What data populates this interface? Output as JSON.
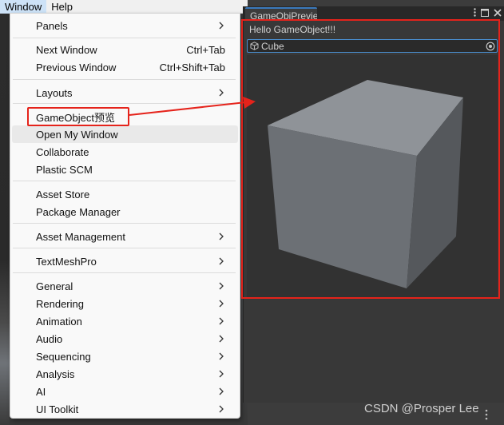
{
  "menubar": {
    "items": [
      "Window",
      "Help"
    ]
  },
  "menu": {
    "items": [
      {
        "label": "Panels",
        "shortcut": "",
        "submenu": true
      },
      {
        "label": "Next Window",
        "shortcut": "Ctrl+Tab",
        "submenu": false
      },
      {
        "label": "Previous Window",
        "shortcut": "Ctrl+Shift+Tab",
        "submenu": false
      },
      {
        "label": "Layouts",
        "shortcut": "",
        "submenu": true
      },
      {
        "label": "GameObject预览",
        "shortcut": "",
        "submenu": false
      },
      {
        "label": "Open My Window",
        "shortcut": "",
        "submenu": false
      },
      {
        "label": "Collaborate",
        "shortcut": "",
        "submenu": false
      },
      {
        "label": "Plastic SCM",
        "shortcut": "",
        "submenu": false
      },
      {
        "label": "Asset Store",
        "shortcut": "",
        "submenu": false
      },
      {
        "label": "Package Manager",
        "shortcut": "",
        "submenu": false
      },
      {
        "label": "Asset Management",
        "shortcut": "",
        "submenu": true
      },
      {
        "label": "TextMeshPro",
        "shortcut": "",
        "submenu": true
      },
      {
        "label": "General",
        "shortcut": "",
        "submenu": true
      },
      {
        "label": "Rendering",
        "shortcut": "",
        "submenu": true
      },
      {
        "label": "Animation",
        "shortcut": "",
        "submenu": true
      },
      {
        "label": "Audio",
        "shortcut": "",
        "submenu": true
      },
      {
        "label": "Sequencing",
        "shortcut": "",
        "submenu": true
      },
      {
        "label": "Analysis",
        "shortcut": "",
        "submenu": true
      },
      {
        "label": "AI",
        "shortcut": "",
        "submenu": true
      },
      {
        "label": "UI Toolkit",
        "shortcut": "",
        "submenu": true
      }
    ]
  },
  "preview": {
    "tab_label": "GameObjPreview",
    "hello_text": "Hello GameObject!!!",
    "object_field_value": "Cube"
  },
  "watermark": "CSDN @Prosper Lee",
  "colors": {
    "highlight": "#e5231b",
    "tab_accent": "#3a79bb",
    "field_border": "#4a8fd0"
  }
}
